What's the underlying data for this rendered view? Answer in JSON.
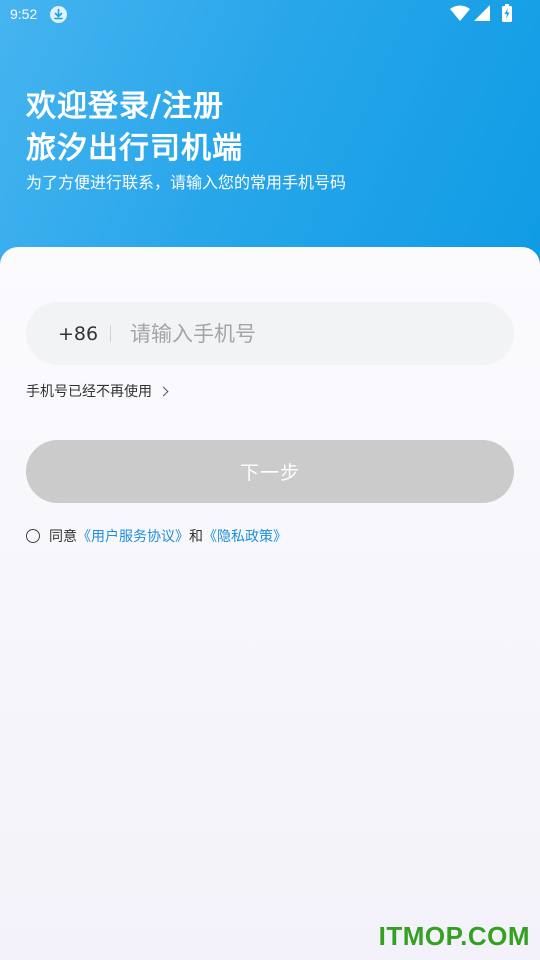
{
  "status_bar": {
    "time": "9:52",
    "icons": [
      "download-notification-icon",
      "wifi-icon",
      "cellular-signal-icon",
      "battery-charging-icon"
    ]
  },
  "header": {
    "title_line1": "欢迎登录/注册",
    "title_line2": "旅汐出行司机端",
    "subtitle": "为了方便进行联系，请输入您的常用手机号码"
  },
  "login": {
    "country_code": "+86",
    "phone_value": "",
    "phone_placeholder": "请输入手机号",
    "no_longer_used_link": "手机号已经不再使用",
    "next_button": "下一步",
    "agree_prefix": "同意",
    "user_agreement": "《用户服务协议》",
    "agree_and": "和",
    "privacy_policy": "《隐私政策》"
  },
  "watermark": "ITMOP.COM",
  "colors": {
    "header_gradient_start": "#46b4f0",
    "header_gradient_end": "#0e9be4",
    "link": "#1d8fdc",
    "button_disabled": "#cbcbcb",
    "watermark": "#35a021"
  }
}
